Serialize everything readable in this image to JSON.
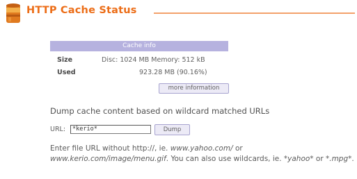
{
  "header": {
    "title": "HTTP Cache Status"
  },
  "cache_info": {
    "title": "Cache info",
    "size_label": "Size",
    "size_value": "Disc: 1024 MB  Memory: 512 kB",
    "used_label": "Used",
    "used_value": "923.28 MB (90.16%)",
    "more_button": "more information"
  },
  "dump": {
    "heading": "Dump cache content based on wildcard matched URLs",
    "url_label": "URL:",
    "url_value": "*kerio*",
    "dump_button": "Dump"
  },
  "help": {
    "t1": "Enter file URL without http://, ie. ",
    "e1": "www.yahoo.com/",
    "t2": " or ",
    "e2": "www.kerio.com/image/menu.gif",
    "t3": ". You can also use wildcards, ie. ",
    "e3": "*yahoo*",
    "t4": " or ",
    "e4": "*.mpg*",
    "t5": "."
  },
  "colors": {
    "accent": "#ec6d17",
    "header_bar": "#b6b2df"
  },
  "icons": {
    "header": "cache-jar-icon"
  }
}
